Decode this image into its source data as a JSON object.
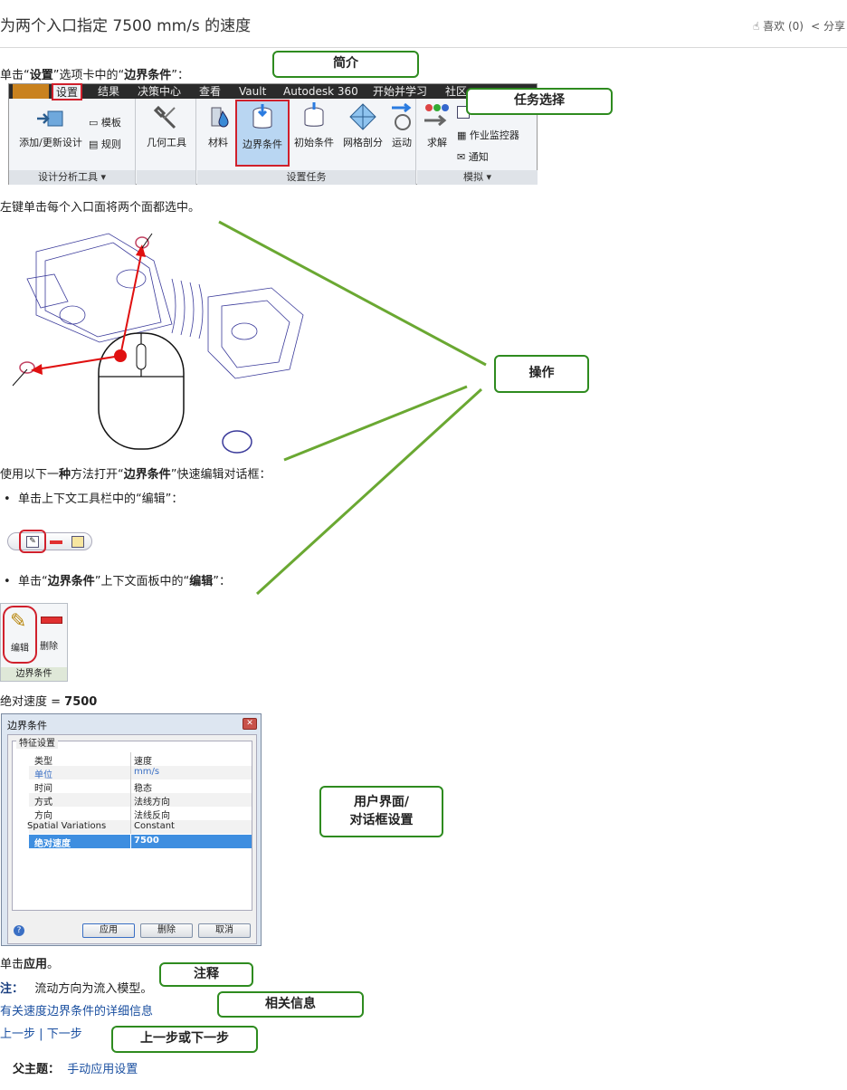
{
  "header": {
    "title": "为两个入口指定 7500 mm/s 的速度",
    "like": "喜欢 (0)",
    "share": "分享"
  },
  "steps": {
    "step1_pre": "单击“",
    "step1_b1": "设置",
    "step1_mid": "”选项卡中的“",
    "step1_b2": "边界条件",
    "step1_post": "”：",
    "step2": "左键单击每个入口面将两个面都选中。",
    "step3_pre": "使用以下一",
    "step3_b1": "种",
    "step3_mid": "方法打开“",
    "step3_b2": "边界条件",
    "step3_post": "”快速编辑对话框：",
    "bullet1": "单击上下文工具栏中的“编辑”：",
    "bullet2_pre": "单击“",
    "bullet2_b1": "边界条件",
    "bullet2_mid": "”上下文面板中的“",
    "bullet2_b2": "编辑",
    "bullet2_post": "”：",
    "abs_pre": "绝对速度 = ",
    "abs_val": "7500",
    "apply_pre": "单击",
    "apply_b": "应用",
    "apply_post": "。",
    "note_label": "注：",
    "note_text": "流动方向为流入模型。",
    "more_link": "有关速度边界条件的详细信息",
    "prev": "上一步",
    "sep": "|",
    "next": "下一步",
    "parent_label": "父主题：",
    "parent_link": "手动应用设置"
  },
  "ribbon": {
    "tabs": [
      "设置",
      "结果",
      "决策中心",
      "查看",
      "Vault",
      "Autodesk 360",
      "开始并学习",
      "社区"
    ],
    "buttons": {
      "add": "添加/更新设计",
      "template": "模板",
      "rule": "规则",
      "geo": "几何工具",
      "material": "材料",
      "bc": "边界条件",
      "ic": "初始条件",
      "mesh": "网格剖分",
      "motion": "运动",
      "solve": "求解",
      "monitor": "作业监控器",
      "notify": "通知"
    },
    "panels": {
      "design": "设计分析工具",
      "setup": "设置任务",
      "sim": "模拟"
    }
  },
  "ctx_panel": {
    "edit": "编辑",
    "delete": "删除",
    "title": "边界条件"
  },
  "dialog": {
    "title": "边界条件",
    "group": "特征设置",
    "rows": [
      {
        "k": "类型",
        "v": "速度"
      },
      {
        "k": "单位",
        "v": "mm/s"
      },
      {
        "k": "时间",
        "v": "稳态"
      },
      {
        "k": "方式",
        "v": "法线方向"
      },
      {
        "k": "方向",
        "v": "法线反向"
      },
      {
        "k": "Spatial Variations",
        "v": "Constant"
      },
      {
        "k": "绝对速度",
        "v": "7500"
      }
    ],
    "apply": "应用",
    "delete": "删除",
    "cancel": "取消"
  },
  "callouts": {
    "intro": "简介",
    "task": "任务选择",
    "op": "操作",
    "ui1": "用户界面/",
    "ui2": "对话框设置",
    "note": "注释",
    "related": "相关信息",
    "nav": "上一步或下一步"
  },
  "colors": {
    "callout_border": "#2e8b1f",
    "highlight": "#d0202c",
    "link": "#1a4fa0",
    "selection": "#3e8ee0"
  }
}
